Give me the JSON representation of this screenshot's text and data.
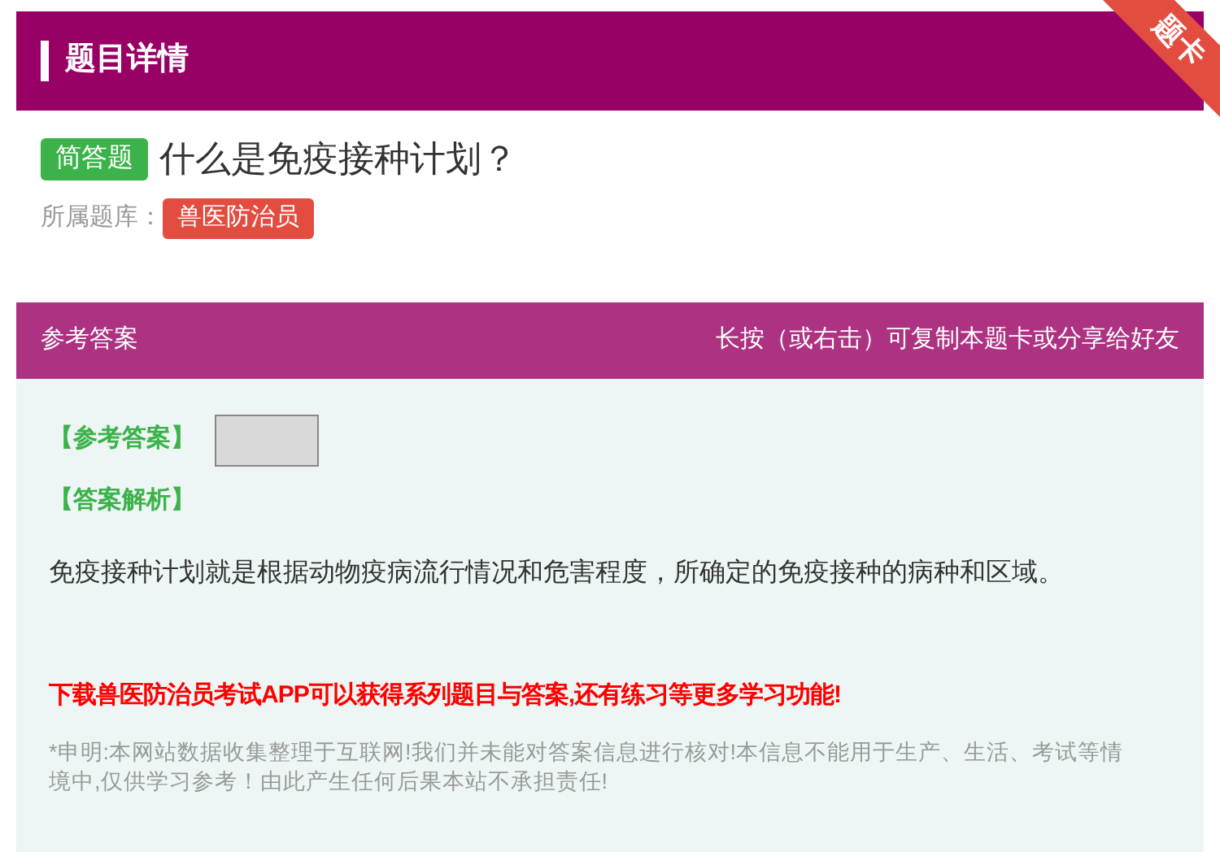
{
  "header": {
    "title": "题目详情",
    "ribbon": "题卡"
  },
  "question": {
    "type_tag": "简答题",
    "text": "什么是免疫接种计划？",
    "library_label": "所属题库：",
    "library_tag": "兽医防治员"
  },
  "answer_panel": {
    "title": "参考答案",
    "hint": "长按（或右击）可复制本题卡或分享给好友",
    "answer_label": "【参考答案】",
    "analysis_label": "【答案解析】",
    "analysis": "免疫接种计划就是根据动物疫病流行情况和危害程度，所确定的免疫接种的病种和区域。",
    "promo": "下载兽医防治员考试APP可以获得系列题目与答案,还有练习等更多学习功能!",
    "disclaimer": "*申明:本网站数据收集整理于互联网!我们并未能对答案信息进行核对!本信息不能用于生产、生活、考试等情境中,仅供学习参考！由此产生任何后果本站不承担责任!"
  }
}
